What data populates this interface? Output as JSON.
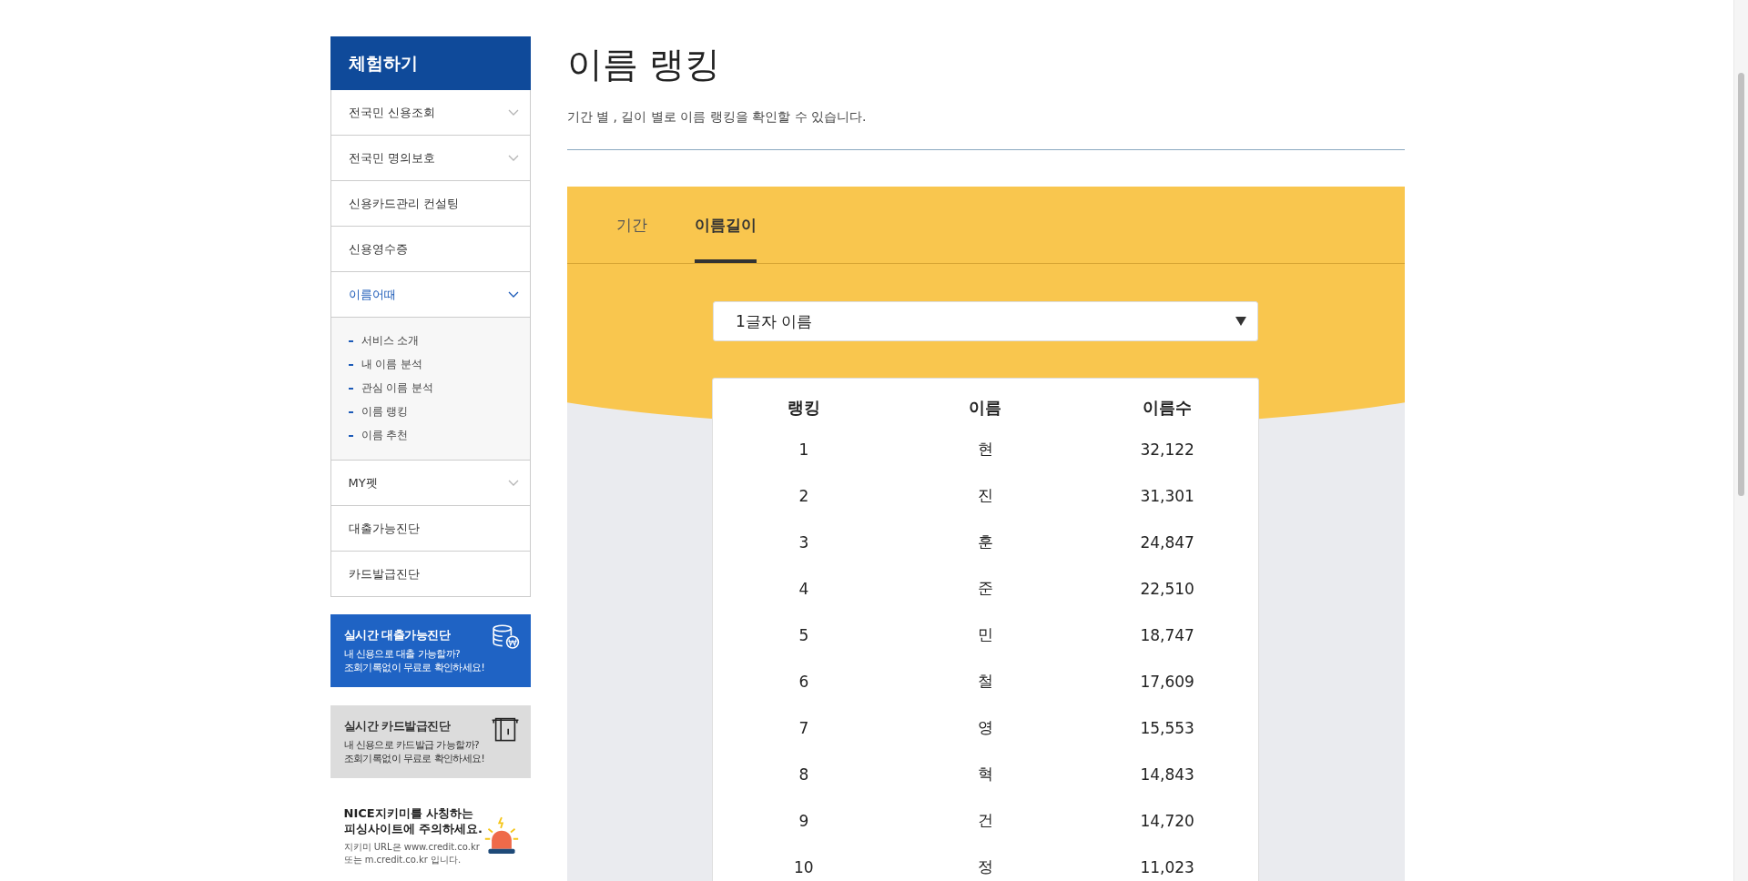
{
  "sidebar": {
    "title": "체험하기",
    "items": [
      {
        "label": "전국민 신용조회",
        "kind": "expandable",
        "expanded": false
      },
      {
        "label": "전국민 명의보호",
        "kind": "expandable",
        "expanded": false
      },
      {
        "label": "신용카드관리 컨설팅",
        "kind": "link"
      },
      {
        "label": "신용영수증",
        "kind": "link"
      },
      {
        "label": "이름어때",
        "kind": "expandable",
        "expanded": true,
        "children": [
          {
            "label": "서비스 소개"
          },
          {
            "label": "내 이름 분석"
          },
          {
            "label": "관심 이름 분석"
          },
          {
            "label": "이름 랭킹"
          },
          {
            "label": "이름 추천"
          }
        ]
      },
      {
        "label": "MY펫",
        "kind": "expandable",
        "expanded": false
      },
      {
        "label": "대출가능진단",
        "kind": "link"
      },
      {
        "label": "카드발급진단",
        "kind": "link"
      }
    ],
    "banners": [
      {
        "kind": "loan",
        "title": "실시간 대출가능진단",
        "lines": [
          "내 신용으로 대출 가능할까?",
          "조회기록없이 무료로 확인하세요!"
        ]
      },
      {
        "kind": "card",
        "title": "실시간 카드발급진단",
        "lines": [
          "내 신용으로 카드발급 가능할까?",
          "조회기록없이 무료로 확인하세요!"
        ]
      }
    ],
    "notice": {
      "title_lines": [
        "NICE지키미를 사칭하는",
        "피싱사이트에 주의하세요."
      ],
      "lines": [
        "지키미 URL은 www.credit.co.kr",
        "또는 m.credit.co.kr 입니다."
      ]
    }
  },
  "page": {
    "title": "이름 랭킹",
    "description": "기간 별 , 길이 별로 이름 랭킹을 확인할 수 있습니다."
  },
  "tabs": [
    {
      "label": "기간",
      "selected": false
    },
    {
      "label": "이름길이",
      "selected": true
    }
  ],
  "select": {
    "value": "1글자 이름"
  },
  "table": {
    "columns": [
      "랭킹",
      "이름",
      "이름수"
    ],
    "rows": [
      [
        "1",
        "현",
        "32,122"
      ],
      [
        "2",
        "진",
        "31,301"
      ],
      [
        "3",
        "훈",
        "24,847"
      ],
      [
        "4",
        "준",
        "22,510"
      ],
      [
        "5",
        "민",
        "18,747"
      ],
      [
        "6",
        "철",
        "17,609"
      ],
      [
        "7",
        "영",
        "15,553"
      ],
      [
        "8",
        "혁",
        "14,843"
      ],
      [
        "9",
        "건",
        "14,720"
      ],
      [
        "10",
        "정",
        "11,023"
      ]
    ]
  }
}
